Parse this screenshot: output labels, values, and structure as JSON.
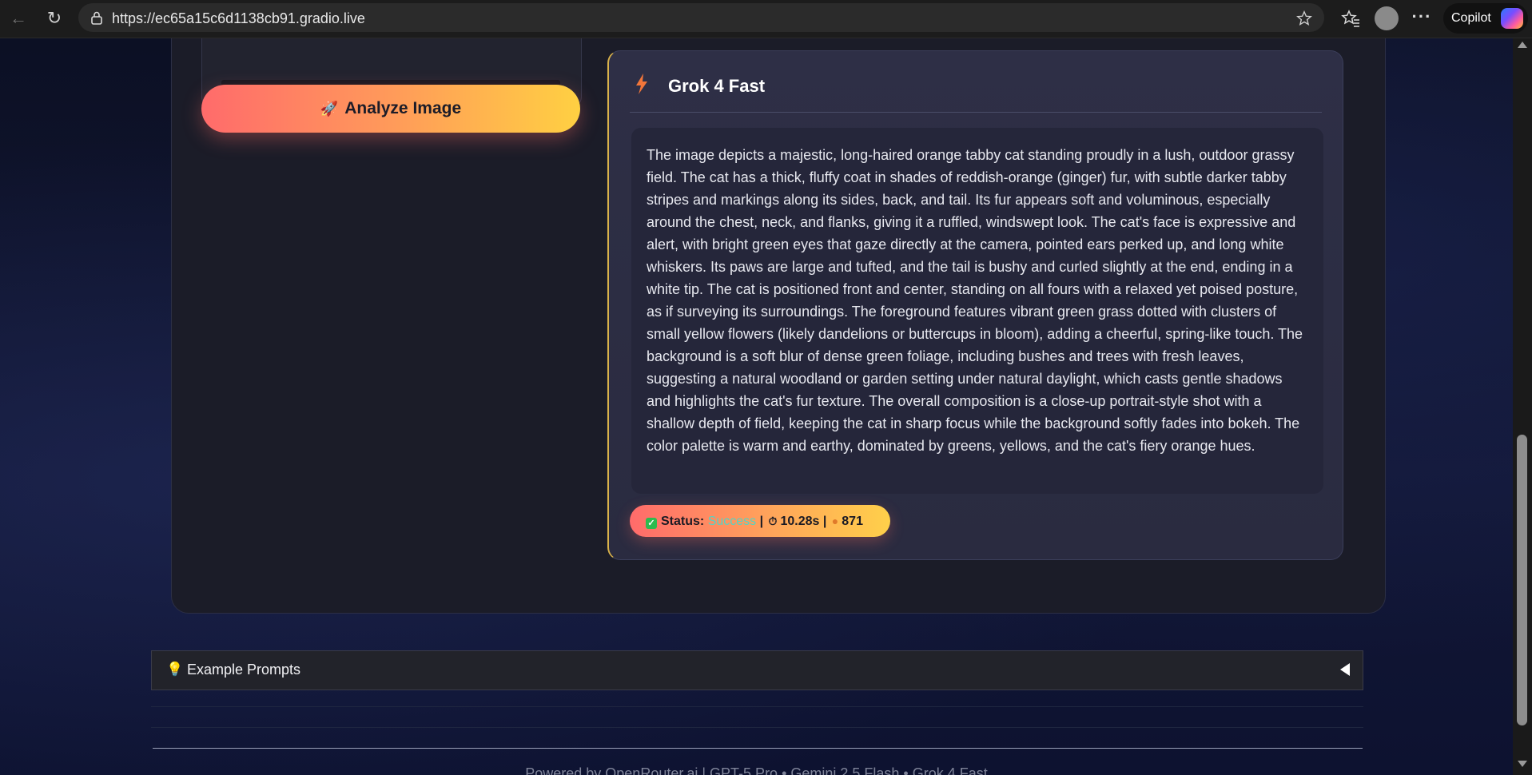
{
  "browser": {
    "url": "https://ec65a15c6d1138cb91.gradio.live",
    "copilot_label": "Copilot"
  },
  "app": {
    "analyze_button_label": "Analyze Image",
    "result": {
      "model_title": "Grok 4 Fast",
      "description": "The image depicts a majestic, long-haired orange tabby cat standing proudly in a lush, outdoor grassy field. The cat has a thick, fluffy coat in shades of reddish-orange (ginger) fur, with subtle darker tabby stripes and markings along its sides, back, and tail. Its fur appears soft and voluminous, especially around the chest, neck, and flanks, giving it a ruffled, windswept look. The cat's face is expressive and alert, with bright green eyes that gaze directly at the camera, pointed ears perked up, and long white whiskers. Its paws are large and tufted, and the tail is bushy and curled slightly at the end, ending in a white tip. The cat is positioned front and center, standing on all fours with a relaxed yet poised posture, as if surveying its surroundings. The foreground features vibrant green grass dotted with clusters of small yellow flowers (likely dandelions or buttercups in bloom), adding a cheerful, spring-like touch. The background is a soft blur of dense green foliage, including bushes and trees with fresh leaves, suggesting a natural woodland or garden setting under natural daylight, which casts gentle shadows and highlights the cat's fur texture. The overall composition is a close-up portrait-style shot with a shallow depth of field, keeping the cat in sharp focus while the background softly fades into bokeh. The color palette is warm and earthy, dominated by greens, yellows, and the cat's fiery orange hues.",
      "status_label": "Status:",
      "status_value": "Success",
      "time_value": "10.28s",
      "token_value": "871"
    },
    "examples_label": "Example Prompts",
    "footer_text": "Powered by OpenRouter.ai | GPT-5 Pro • Gemini 2.5 Flash • Grok 4 Fast"
  },
  "colors": {
    "accent_gradient_start": "#ff6b6b",
    "accent_gradient_end": "#ffd042",
    "status_success": "#53d4c5"
  }
}
